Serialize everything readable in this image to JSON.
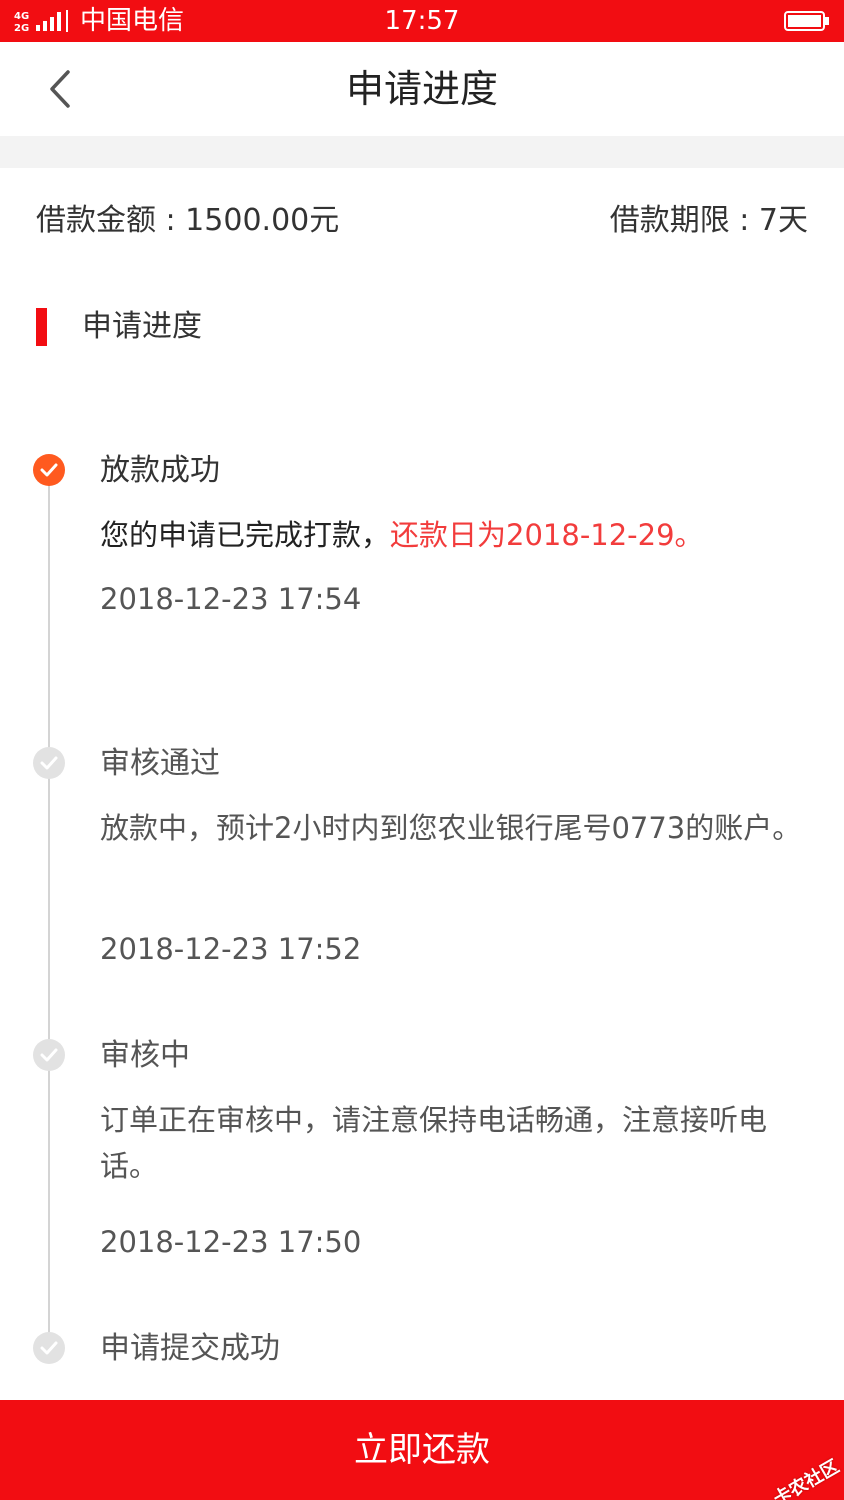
{
  "status_bar": {
    "carrier": "中国电信",
    "time": "17:57",
    "network": "4G 2G"
  },
  "nav": {
    "title": "申请进度",
    "back_icon": "chevron-left-icon"
  },
  "summary": {
    "amount_text": "借款金额 : 1500.00元",
    "term_text": "借款期限 : 7天"
  },
  "section": {
    "label": "申请进度"
  },
  "steps": [
    {
      "title": "放款成功",
      "desc_normal": "您的申请已完成打款，",
      "desc_highlight": "还款日为2018-12-29。",
      "time": "2018-12-23 17:54",
      "state": "active"
    },
    {
      "title": "审核通过",
      "desc": "放款中，预计2小时内到您农业银行尾号0773的账户。",
      "time": "2018-12-23 17:52",
      "state": "done"
    },
    {
      "title": "审核中",
      "desc": "订单正在审核中，请注意保持电话畅通，注意接听电话。",
      "time": "2018-12-23 17:50",
      "state": "done"
    },
    {
      "title": "申请提交成功",
      "state": "done"
    }
  ],
  "action": {
    "repay_label": "立即还款"
  },
  "watermark": {
    "text": "卡农社区"
  },
  "colors": {
    "brand_red": "#f20d12",
    "active_orange": "#ff5a1f",
    "highlight_red": "#f23c3c"
  }
}
